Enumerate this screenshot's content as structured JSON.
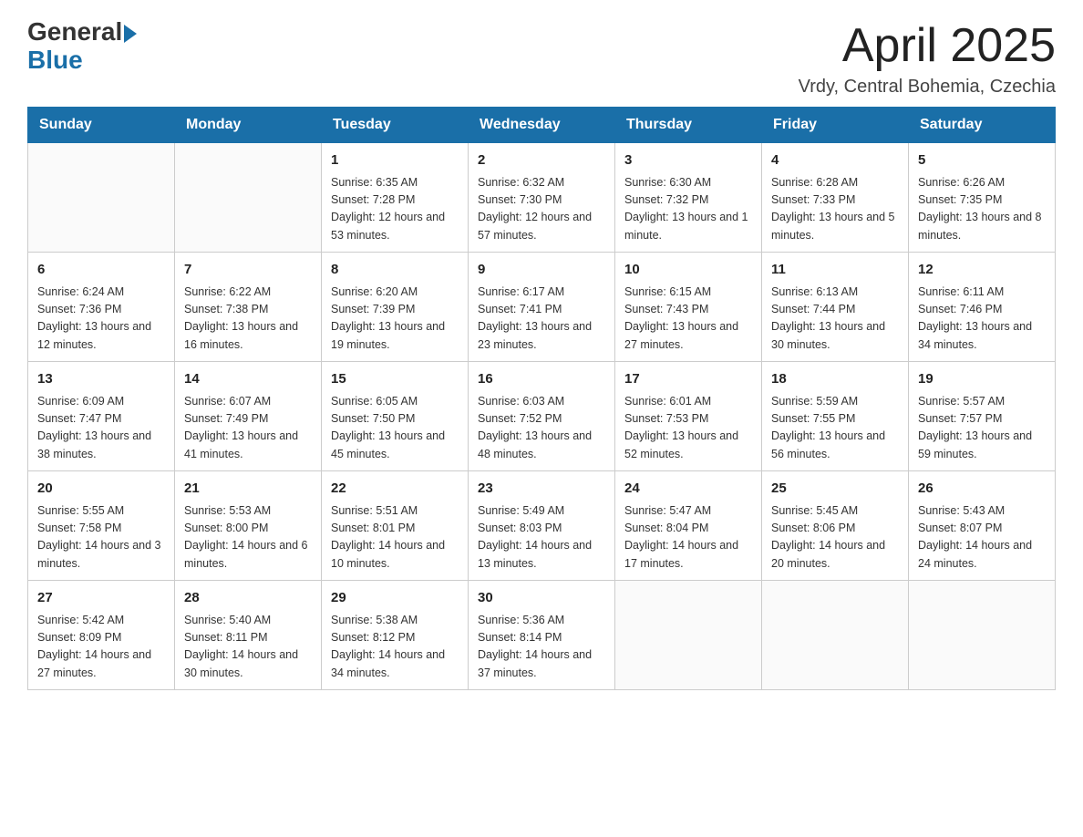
{
  "header": {
    "logo": {
      "general": "General",
      "blue": "Blue"
    },
    "title": "April 2025",
    "location": "Vrdy, Central Bohemia, Czechia"
  },
  "weekdays": [
    "Sunday",
    "Monday",
    "Tuesday",
    "Wednesday",
    "Thursday",
    "Friday",
    "Saturday"
  ],
  "weeks": [
    [
      {
        "day": "",
        "info": ""
      },
      {
        "day": "",
        "info": ""
      },
      {
        "day": "1",
        "info": "Sunrise: 6:35 AM\nSunset: 7:28 PM\nDaylight: 12 hours\nand 53 minutes."
      },
      {
        "day": "2",
        "info": "Sunrise: 6:32 AM\nSunset: 7:30 PM\nDaylight: 12 hours\nand 57 minutes."
      },
      {
        "day": "3",
        "info": "Sunrise: 6:30 AM\nSunset: 7:32 PM\nDaylight: 13 hours\nand 1 minute."
      },
      {
        "day": "4",
        "info": "Sunrise: 6:28 AM\nSunset: 7:33 PM\nDaylight: 13 hours\nand 5 minutes."
      },
      {
        "day": "5",
        "info": "Sunrise: 6:26 AM\nSunset: 7:35 PM\nDaylight: 13 hours\nand 8 minutes."
      }
    ],
    [
      {
        "day": "6",
        "info": "Sunrise: 6:24 AM\nSunset: 7:36 PM\nDaylight: 13 hours\nand 12 minutes."
      },
      {
        "day": "7",
        "info": "Sunrise: 6:22 AM\nSunset: 7:38 PM\nDaylight: 13 hours\nand 16 minutes."
      },
      {
        "day": "8",
        "info": "Sunrise: 6:20 AM\nSunset: 7:39 PM\nDaylight: 13 hours\nand 19 minutes."
      },
      {
        "day": "9",
        "info": "Sunrise: 6:17 AM\nSunset: 7:41 PM\nDaylight: 13 hours\nand 23 minutes."
      },
      {
        "day": "10",
        "info": "Sunrise: 6:15 AM\nSunset: 7:43 PM\nDaylight: 13 hours\nand 27 minutes."
      },
      {
        "day": "11",
        "info": "Sunrise: 6:13 AM\nSunset: 7:44 PM\nDaylight: 13 hours\nand 30 minutes."
      },
      {
        "day": "12",
        "info": "Sunrise: 6:11 AM\nSunset: 7:46 PM\nDaylight: 13 hours\nand 34 minutes."
      }
    ],
    [
      {
        "day": "13",
        "info": "Sunrise: 6:09 AM\nSunset: 7:47 PM\nDaylight: 13 hours\nand 38 minutes."
      },
      {
        "day": "14",
        "info": "Sunrise: 6:07 AM\nSunset: 7:49 PM\nDaylight: 13 hours\nand 41 minutes."
      },
      {
        "day": "15",
        "info": "Sunrise: 6:05 AM\nSunset: 7:50 PM\nDaylight: 13 hours\nand 45 minutes."
      },
      {
        "day": "16",
        "info": "Sunrise: 6:03 AM\nSunset: 7:52 PM\nDaylight: 13 hours\nand 48 minutes."
      },
      {
        "day": "17",
        "info": "Sunrise: 6:01 AM\nSunset: 7:53 PM\nDaylight: 13 hours\nand 52 minutes."
      },
      {
        "day": "18",
        "info": "Sunrise: 5:59 AM\nSunset: 7:55 PM\nDaylight: 13 hours\nand 56 minutes."
      },
      {
        "day": "19",
        "info": "Sunrise: 5:57 AM\nSunset: 7:57 PM\nDaylight: 13 hours\nand 59 minutes."
      }
    ],
    [
      {
        "day": "20",
        "info": "Sunrise: 5:55 AM\nSunset: 7:58 PM\nDaylight: 14 hours\nand 3 minutes."
      },
      {
        "day": "21",
        "info": "Sunrise: 5:53 AM\nSunset: 8:00 PM\nDaylight: 14 hours\nand 6 minutes."
      },
      {
        "day": "22",
        "info": "Sunrise: 5:51 AM\nSunset: 8:01 PM\nDaylight: 14 hours\nand 10 minutes."
      },
      {
        "day": "23",
        "info": "Sunrise: 5:49 AM\nSunset: 8:03 PM\nDaylight: 14 hours\nand 13 minutes."
      },
      {
        "day": "24",
        "info": "Sunrise: 5:47 AM\nSunset: 8:04 PM\nDaylight: 14 hours\nand 17 minutes."
      },
      {
        "day": "25",
        "info": "Sunrise: 5:45 AM\nSunset: 8:06 PM\nDaylight: 14 hours\nand 20 minutes."
      },
      {
        "day": "26",
        "info": "Sunrise: 5:43 AM\nSunset: 8:07 PM\nDaylight: 14 hours\nand 24 minutes."
      }
    ],
    [
      {
        "day": "27",
        "info": "Sunrise: 5:42 AM\nSunset: 8:09 PM\nDaylight: 14 hours\nand 27 minutes."
      },
      {
        "day": "28",
        "info": "Sunrise: 5:40 AM\nSunset: 8:11 PM\nDaylight: 14 hours\nand 30 minutes."
      },
      {
        "day": "29",
        "info": "Sunrise: 5:38 AM\nSunset: 8:12 PM\nDaylight: 14 hours\nand 34 minutes."
      },
      {
        "day": "30",
        "info": "Sunrise: 5:36 AM\nSunset: 8:14 PM\nDaylight: 14 hours\nand 37 minutes."
      },
      {
        "day": "",
        "info": ""
      },
      {
        "day": "",
        "info": ""
      },
      {
        "day": "",
        "info": ""
      }
    ]
  ]
}
